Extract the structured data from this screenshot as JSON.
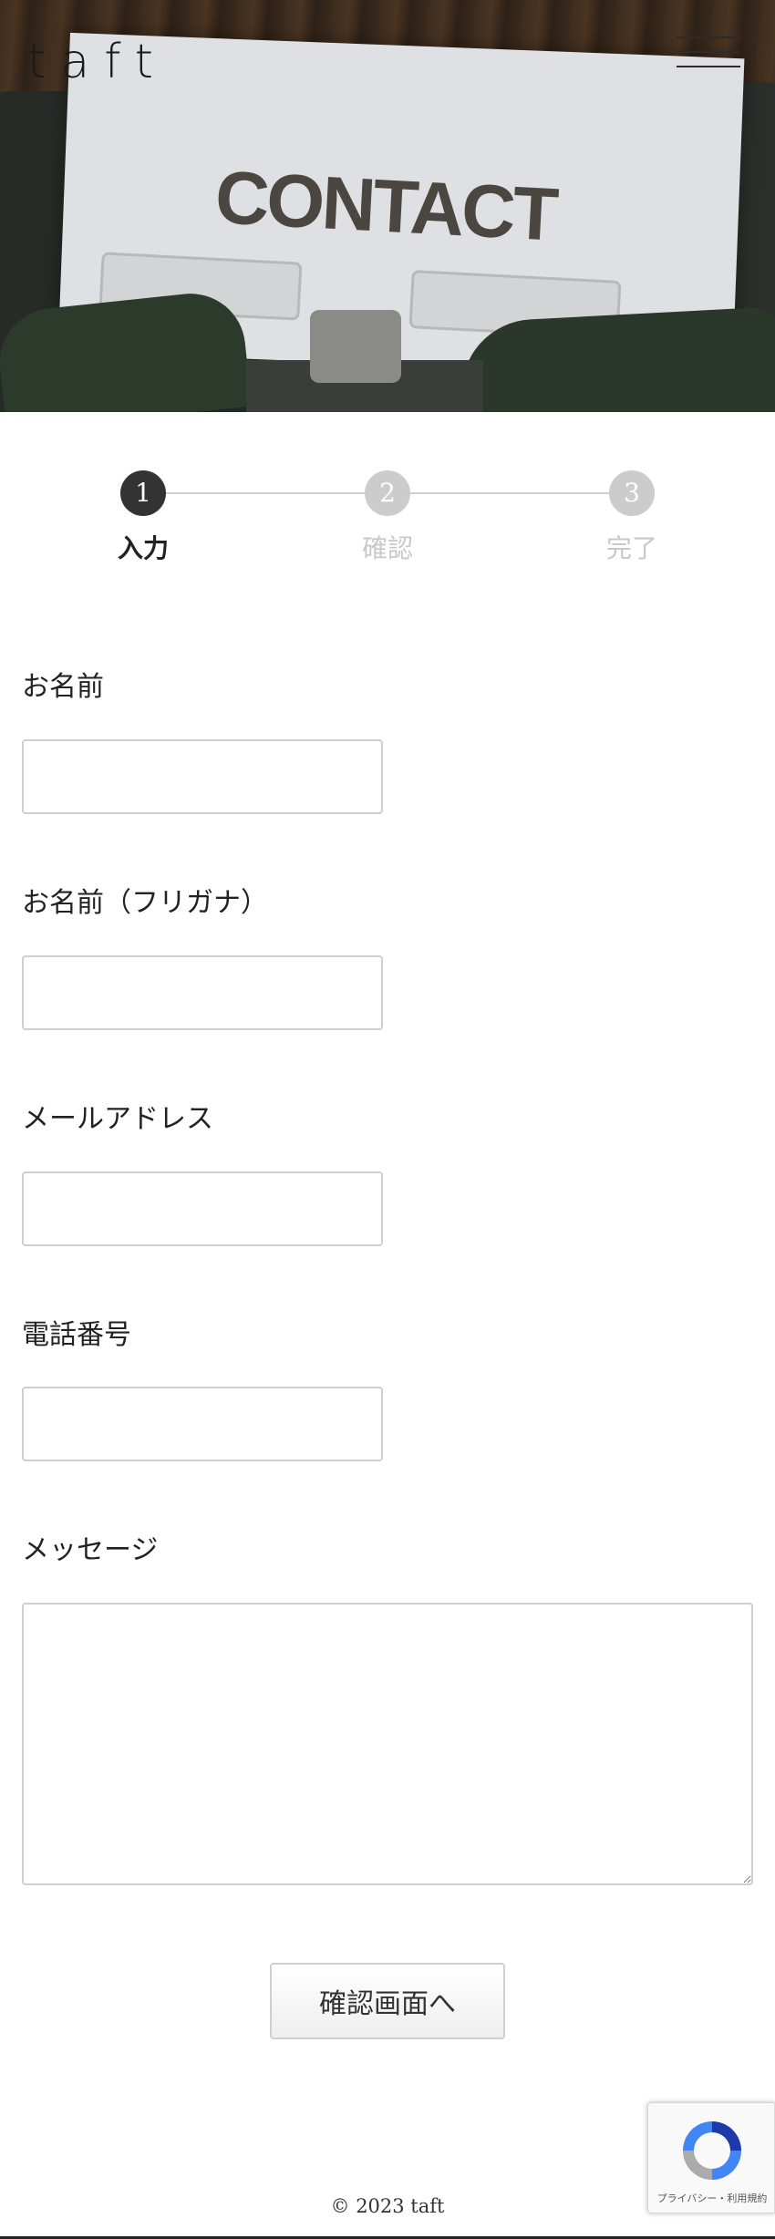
{
  "header": {
    "logo_text": "taft",
    "hero_text": "CONTACT",
    "menu_icon": "hamburger-menu-icon"
  },
  "steps": [
    {
      "number": "1",
      "label": "入力",
      "state": "active"
    },
    {
      "number": "2",
      "label": "確認",
      "state": "inactive"
    },
    {
      "number": "3",
      "label": "完了",
      "state": "inactive"
    }
  ],
  "form": {
    "name_label": "お名前",
    "name_value": "",
    "furigana_label": "お名前（フリガナ）",
    "furigana_value": "",
    "email_label": "メールアドレス",
    "email_value": "",
    "phone_label": "電話番号",
    "phone_value": "",
    "message_label": "メッセージ",
    "message_value": "",
    "submit_label": "確認画面へ"
  },
  "recaptcha": {
    "text": "プライバシー・利用規約",
    "icon": "recaptcha-icon"
  },
  "footer": {
    "copyright": "© 2023 taft"
  },
  "colors": {
    "active_step": "#333333",
    "inactive_step": "#cccccc",
    "border": "#cfcfcf"
  }
}
